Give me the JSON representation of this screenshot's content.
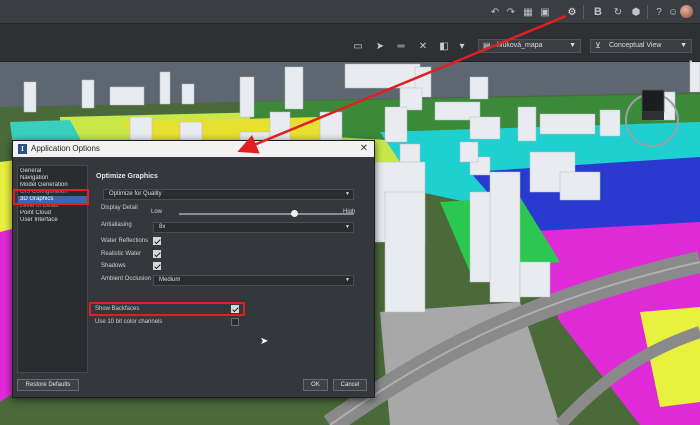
{
  "topbar": {
    "icons": [
      "undo-icon",
      "redo-icon",
      "grid-icon",
      "gear-icon",
      "bold-b-icon",
      "refresh-icon",
      "cube-icon",
      "help-icon",
      "avatar"
    ]
  },
  "toolbar": {
    "layer_dropdown": "hlúková_mapa",
    "view_dropdown": "Conceptual View"
  },
  "dialog": {
    "title": "Application Options",
    "nav_items": [
      "General",
      "Navigation",
      "Model Generation",
      "GIS Configuration",
      "3D Graphics",
      "Level of Detail",
      "Point Cloud",
      "User Interface"
    ],
    "selected_nav": "3D Graphics",
    "section_title": "Optimize Graphics",
    "optimize_value": "Optimize for Quality",
    "display_detail_label": "Display Detail",
    "low_label": "Low",
    "high_label": "High",
    "display_detail_level": 0.67,
    "antialiasing_label": "Antialiasing",
    "antialiasing_value": "8x",
    "water_reflections_label": "Water Reflections",
    "realistic_water_label": "Realistic Water",
    "shadows_label": "Shadows",
    "ambient_occlusion_label": "Ambient Occlusion",
    "ambient_occlusion_value": "Medium",
    "show_backfaces_label": "Show Backfaces",
    "color_channels_label": "Use 10 bit color channels",
    "restore_defaults": "Restore Defaults",
    "ok": "OK",
    "cancel": "Cancel"
  },
  "colors": {
    "annotation_red": "#e02020",
    "selection_blue": "#3c66b0"
  }
}
